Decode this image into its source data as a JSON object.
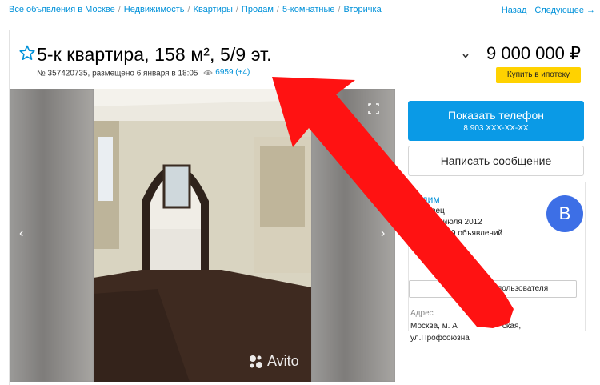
{
  "breadcrumbs": [
    "Все объявления в Москве",
    "Недвижимость",
    "Квартиры",
    "Продам",
    "5-комнатные",
    "Вторичка"
  ],
  "topnav": {
    "back": "Назад",
    "next": "Следующее →"
  },
  "listing": {
    "title": "5-к квартира, 158 м², 5/9 эт.",
    "meta": "№ 357420735, размещено 6 января в 18:05",
    "views": "6959 (+4)",
    "price": "9 000 000 ₽",
    "mortgage_label": "Купить в ипотеку"
  },
  "gallery": {
    "watermark": "Avito"
  },
  "contact": {
    "phone_label": "Показать телефон",
    "phone_masked": "8 903 XXX-XX-XX",
    "message_label": "Написать сообщение"
  },
  "seller": {
    "name": "Вадим",
    "role": "родавец",
    "since": "Avito с июля 2012",
    "ads": "ено 19 объявлений",
    "avatar_letter": "В",
    "user_ads_button": "вления пользователя"
  },
  "address": {
    "label": "Адрес",
    "line1": "Москва, м. А",
    "line1_end": "ская,",
    "line2": "ул.Профсоюзна"
  },
  "colors": {
    "link": "#0091d9",
    "phone_button": "#0a9ae6",
    "mortgage": "#ffd200",
    "avatar": "#3d6fe6",
    "arrow": "#ff1212"
  }
}
